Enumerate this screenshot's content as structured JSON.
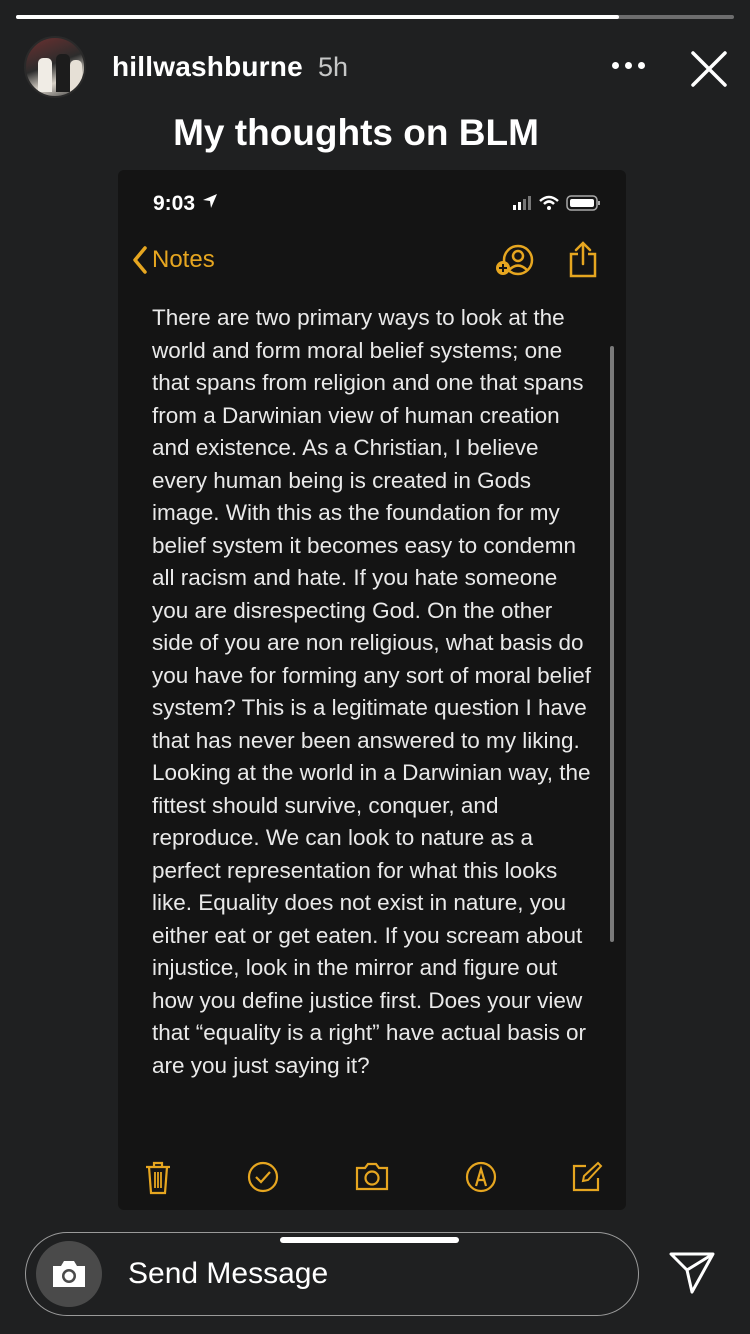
{
  "story": {
    "progress_fraction": 0.84,
    "username": "hillwashburne",
    "time_ago": "5h",
    "title": "My thoughts on BLM"
  },
  "notes_screenshot": {
    "status_time": "9:03",
    "back_label": "Notes",
    "body": "There are two primary ways to look at the world and form moral belief systems; one that spans from religion and one that spans from a Darwinian view of human creation and existence. As a Christian, I believe every human being is created in Gods image. With this as the foundation for my belief system it becomes easy to condemn all racism and hate. If you hate someone you are disrespecting God. On the other side of you are non religious, what basis do you have for forming any sort of moral belief system? This is a legitimate question I have that has never been answered to my liking. Looking at the world in a Darwinian way, the fittest should survive, conquer, and reproduce. We can look to nature as a perfect representation for what this looks like. Equality does not exist in nature, you either eat or get eaten. If you scream about injustice, look in the mirror and figure out how you define justice first. Does your view that “equality is a right” have actual basis or are you just saying it?",
    "accent_color": "#e6a620",
    "toolbar_icons": [
      "trash-icon",
      "checklist-icon",
      "camera-icon",
      "markup-icon",
      "compose-icon"
    ]
  },
  "reply": {
    "placeholder": "Send Message"
  },
  "colors": {
    "background": "#1f2021",
    "text": "#ffffff"
  }
}
